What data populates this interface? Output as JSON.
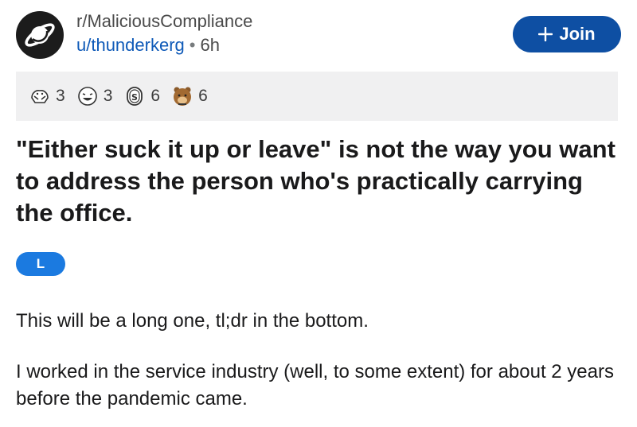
{
  "post": {
    "subreddit": "r/MaliciousCompliance",
    "author": "u/thunderkerg",
    "separator": "•",
    "age": "6h",
    "join_label": "Join",
    "awards": [
      {
        "icon": "hugz-award-icon",
        "count": "3"
      },
      {
        "icon": "laughing-face-award-icon",
        "count": "3"
      },
      {
        "icon": "silver-award-icon",
        "count": "6"
      },
      {
        "icon": "bear-award-icon",
        "count": "6"
      }
    ],
    "title": "\"Either suck it up or leave\" is not the way you want to address the person who's practically carrying the office.",
    "flair": "L",
    "body": [
      "This will be a long one, tl;dr in the bottom.",
      "I worked in the service industry (well, to some extent) for about 2 years before the pandemic came."
    ]
  },
  "colors": {
    "link_blue": "#0f5ab8",
    "join_button": "#0e4fa3",
    "flair_blue": "#1b7ae0",
    "awards_bar_bg": "#f0f0f1"
  }
}
